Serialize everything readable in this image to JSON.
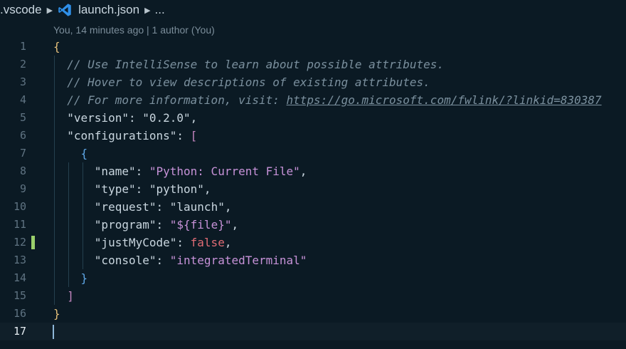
{
  "breadcrumb": {
    "folder": ".vscode",
    "file": "launch.json",
    "more": "..."
  },
  "codelens": "You, 14 minutes ago | 1 author (You)",
  "lines": [
    {
      "n": "1",
      "tokens": [
        {
          "t": "{",
          "c": "brace"
        }
      ]
    },
    {
      "n": "2",
      "tokens": [
        {
          "t": "  ",
          "c": "punc"
        },
        {
          "t": "// Use IntelliSense to learn about possible attributes.",
          "c": "comment"
        }
      ]
    },
    {
      "n": "3",
      "tokens": [
        {
          "t": "  ",
          "c": "punc"
        },
        {
          "t": "// Hover to view descriptions of existing attributes.",
          "c": "comment"
        }
      ]
    },
    {
      "n": "4",
      "tokens": [
        {
          "t": "  ",
          "c": "punc"
        },
        {
          "t": "// For more information, visit: ",
          "c": "comment"
        },
        {
          "t": "https://go.microsoft.com/fwlink/?linkid=830387",
          "c": "link"
        }
      ]
    },
    {
      "n": "5",
      "tokens": [
        {
          "t": "  ",
          "c": "punc"
        },
        {
          "t": "\"version\"",
          "c": "key"
        },
        {
          "t": ": ",
          "c": "punc"
        },
        {
          "t": "\"0.2.0\"",
          "c": "str"
        },
        {
          "t": ",",
          "c": "punc"
        }
      ]
    },
    {
      "n": "6",
      "tokens": [
        {
          "t": "  ",
          "c": "punc"
        },
        {
          "t": "\"configurations\"",
          "c": "key"
        },
        {
          "t": ": ",
          "c": "punc"
        },
        {
          "t": "[",
          "c": "bracket"
        }
      ]
    },
    {
      "n": "7",
      "tokens": [
        {
          "t": "    ",
          "c": "punc"
        },
        {
          "t": "{",
          "c": "brace2"
        }
      ]
    },
    {
      "n": "8",
      "tokens": [
        {
          "t": "      ",
          "c": "punc"
        },
        {
          "t": "\"name\"",
          "c": "key"
        },
        {
          "t": ": ",
          "c": "punc"
        },
        {
          "t": "\"Python: Current File\"",
          "c": "strv"
        },
        {
          "t": ",",
          "c": "punc"
        }
      ]
    },
    {
      "n": "9",
      "tokens": [
        {
          "t": "      ",
          "c": "punc"
        },
        {
          "t": "\"type\"",
          "c": "key"
        },
        {
          "t": ": ",
          "c": "punc"
        },
        {
          "t": "\"python\"",
          "c": "str"
        },
        {
          "t": ",",
          "c": "punc"
        }
      ]
    },
    {
      "n": "10",
      "tokens": [
        {
          "t": "      ",
          "c": "punc"
        },
        {
          "t": "\"request\"",
          "c": "key"
        },
        {
          "t": ": ",
          "c": "punc"
        },
        {
          "t": "\"launch\"",
          "c": "str"
        },
        {
          "t": ",",
          "c": "punc"
        }
      ]
    },
    {
      "n": "11",
      "tokens": [
        {
          "t": "      ",
          "c": "punc"
        },
        {
          "t": "\"program\"",
          "c": "key"
        },
        {
          "t": ": ",
          "c": "punc"
        },
        {
          "t": "\"${file}\"",
          "c": "strv"
        },
        {
          "t": ",",
          "c": "punc"
        }
      ]
    },
    {
      "n": "12",
      "tokens": [
        {
          "t": "      ",
          "c": "punc"
        },
        {
          "t": "\"justMyCode\"",
          "c": "key"
        },
        {
          "t": ": ",
          "c": "punc"
        },
        {
          "t": "false",
          "c": "bool"
        },
        {
          "t": ",",
          "c": "punc"
        }
      ]
    },
    {
      "n": "13",
      "tokens": [
        {
          "t": "      ",
          "c": "punc"
        },
        {
          "t": "\"console\"",
          "c": "key"
        },
        {
          "t": ": ",
          "c": "punc"
        },
        {
          "t": "\"integratedTerminal\"",
          "c": "strv"
        }
      ]
    },
    {
      "n": "14",
      "tokens": [
        {
          "t": "    ",
          "c": "punc"
        },
        {
          "t": "}",
          "c": "brace2"
        }
      ]
    },
    {
      "n": "15",
      "tokens": [
        {
          "t": "  ",
          "c": "punc"
        },
        {
          "t": "]",
          "c": "bracket"
        }
      ]
    },
    {
      "n": "16",
      "tokens": [
        {
          "t": "}",
          "c": "brace"
        }
      ]
    },
    {
      "n": "17",
      "tokens": []
    }
  ],
  "active_line": "17",
  "modified_line": "12",
  "colors": {
    "background": "#0b1a24",
    "brace": "#e5c07b",
    "bracket": "#c586c0",
    "inner_brace": "#5fa8e8",
    "string_value": "#c792d8",
    "boolean": "#e06c75",
    "comment": "#7b909e",
    "modified_marker": "#9acf6b"
  },
  "icons": {
    "file_type": "vscode-icon",
    "separator": "chevron-right-icon"
  }
}
